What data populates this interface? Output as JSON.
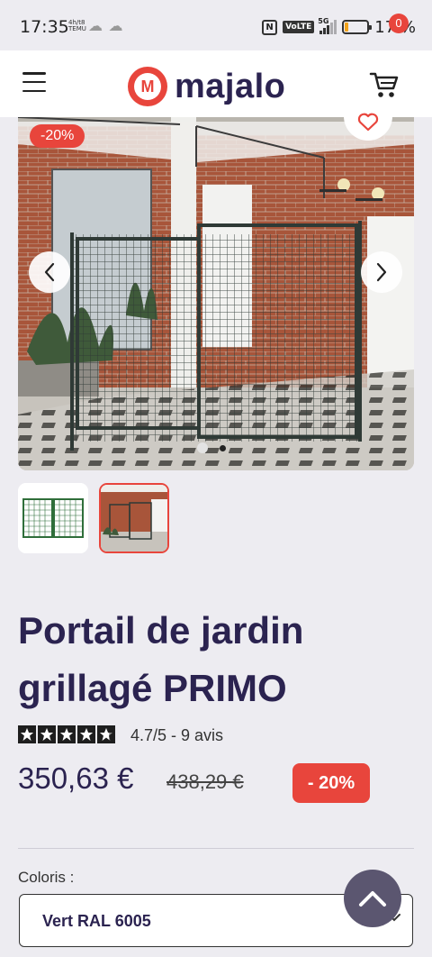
{
  "status_bar": {
    "time": "17:35",
    "notif_line1": "4h/t8",
    "notif_line2": "TEMU",
    "notif_icons": "☁ ☁",
    "nfc_label": "N",
    "volte_label": "VoLTE",
    "network_label": "5G",
    "battery_percent": "17 %",
    "battery_level": 0.17,
    "battery_color": "#f2a31b"
  },
  "header": {
    "brand": "majalo",
    "brand_mark": "M",
    "cart_count": "0",
    "brand_color": "#e8453c",
    "brand_text_color": "#2b2350"
  },
  "gallery": {
    "discount_tag": "-20%",
    "current_index": 1,
    "total_images": 2
  },
  "product": {
    "title_line1": "Portail de jardin",
    "title_line2": "grillagé PRIMO",
    "rating": 4.7,
    "rating_text": "4.7/5 - 9 avis",
    "price": "350,63 €",
    "old_price": "438,29 €",
    "discount_badge": "- 20%"
  },
  "options": {
    "color_label": "Coloris :",
    "color_selected": "Vert RAL 6005"
  },
  "icons": {
    "menu": "menu-icon",
    "cart": "cart-icon",
    "favorite": "heart-icon",
    "prev": "chevron-left-icon",
    "next": "chevron-right-icon",
    "select": "chevron-down-icon",
    "scroll_top": "chevron-up-icon"
  }
}
